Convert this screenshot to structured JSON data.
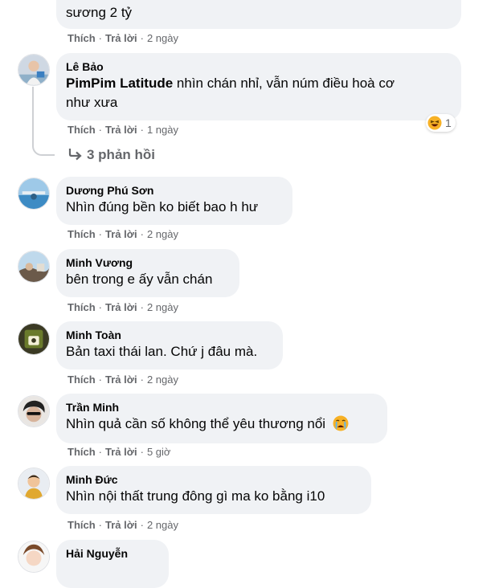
{
  "action_like": "Thích",
  "action_reply": "Trả lời",
  "comments": [
    {
      "text_tail": "sương 2 tỷ",
      "time": "2 ngày"
    },
    {
      "author": "Lê Bảo",
      "mention": "PimPim Latitude",
      "text_line1": "nhìn chán nhỉ, vẫn núm điều hoà cơ",
      "text_line2": "như xưa",
      "time": "1 ngày",
      "reaction": {
        "icon": "laughing-emoji",
        "count": "1"
      },
      "replies_link": "3 phản hồi"
    },
    {
      "author": "Dương Phú Sơn",
      "text": "Nhìn đúng bền ko biết bao h hư",
      "time": "2 ngày"
    },
    {
      "author": "Minh Vương",
      "text": "bên trong e ấy vẫn chán",
      "time": "2 ngày"
    },
    {
      "author": "Minh Toàn",
      "text": "Bản taxi thái lan. Chứ j đâu mà.",
      "time": "2 ngày"
    },
    {
      "author": "Trần Minh",
      "text": "Nhìn quả cần số không thể yêu thương nổi",
      "emoji": "crying-emoji",
      "time": "5 giờ"
    },
    {
      "author": "Minh Đức",
      "text": "Nhìn nội thất trung đông gì ma ko bằng i10",
      "time": "2 ngày"
    },
    {
      "author": "Hải Nguyễn"
    }
  ],
  "colors": {
    "bubble": "#f0f2f5",
    "meta_text": "#65676b",
    "primary_text": "#050505",
    "thread_line": "#ced0d4",
    "emoji_yellow": "#f7b125"
  }
}
